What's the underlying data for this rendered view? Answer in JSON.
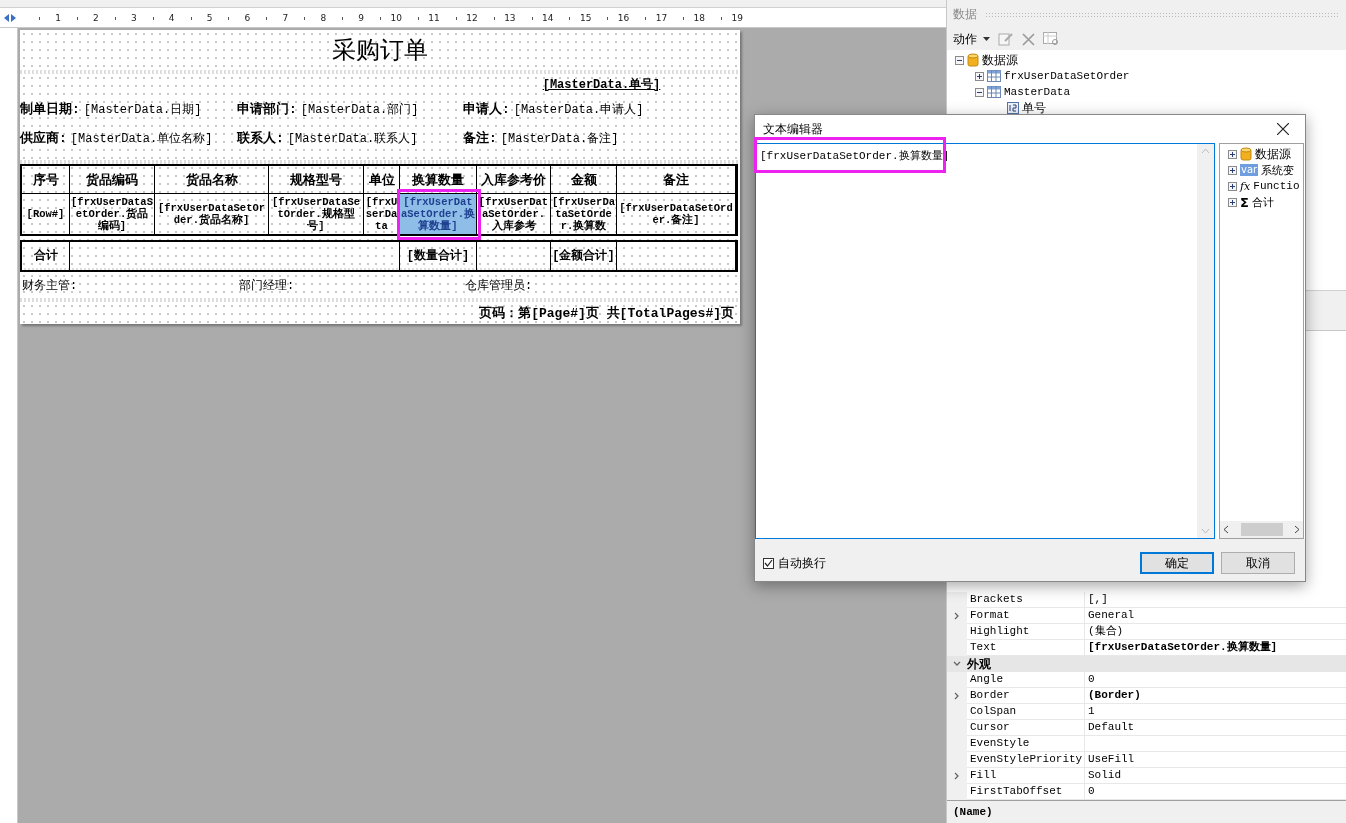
{
  "ruler": {
    "ticks": [
      "1",
      "2",
      "3",
      "4",
      "5",
      "6",
      "7",
      "8",
      "9",
      "10",
      "11",
      "12",
      "13",
      "14",
      "15",
      "16",
      "17",
      "18",
      "19"
    ]
  },
  "report": {
    "title": "采购订单",
    "order_number": "[MasterData.单号]",
    "header_rows": [
      [
        {
          "label": "制单日期:",
          "value": "[MasterData.日期]"
        },
        {
          "label": "申请部门:",
          "value": "[MasterData.部门]"
        },
        {
          "label": "申请人:",
          "value": "[MasterData.申请人]"
        }
      ],
      [
        {
          "label": "供应商:",
          "value": "[MasterData.单位名称]"
        },
        {
          "label": "联系人:",
          "value": "[MasterData.联系人]"
        },
        {
          "label": "备注:",
          "value": "[MasterData.备注]"
        }
      ]
    ],
    "columns": [
      "序号",
      "货品编码",
      "货品名称",
      "规格型号",
      "单位",
      "换算数量",
      "入库参考价",
      "金额",
      "备注"
    ],
    "data_row": [
      {
        "text": "[Row#]",
        "selected": false
      },
      {
        "text": "[frxUserDataSetOrder.货品编码]",
        "selected": false
      },
      {
        "text": "[frxUserDataSetOrder.货品名称]",
        "selected": false
      },
      {
        "text": "[frxUserDataSetOrder.规格型号]",
        "selected": false
      },
      {
        "text": "[frxUserData",
        "selected": false
      },
      {
        "text": "[frxUserDataSetOrder.换算数量]",
        "selected": true,
        "highlighted": true
      },
      {
        "text": "[frxUserDataSetOrder.入库参考",
        "selected": false
      },
      {
        "text": "[frxUserDataSetOrder.换算数",
        "selected": false
      },
      {
        "text": "[frxUserDataSetOrder.备注]",
        "selected": false
      }
    ],
    "totals": {
      "label": "合计",
      "quantity": "[数量合计]",
      "amount": "[金额合计]"
    },
    "signatures": [
      "财务主管:",
      "部门经理:",
      "仓库管理员:"
    ],
    "page_footer": "页码：第[Page#]页 共[TotalPages#]页"
  },
  "data_panel": {
    "title": "数据",
    "action": "动作",
    "tree": [
      {
        "label": "数据源",
        "kind": "database",
        "expanded": true,
        "children": [
          {
            "label": "frxUserDataSetOrder",
            "kind": "table",
            "expanded": false
          },
          {
            "label": "MasterData",
            "kind": "table",
            "expanded": true,
            "children": [
              {
                "label": "单号",
                "kind": "field"
              }
            ]
          }
        ]
      }
    ]
  },
  "properties": {
    "rows": [
      {
        "kind": "property",
        "name": "Brackets",
        "value": "[,]"
      },
      {
        "kind": "property",
        "name": "Format",
        "value": "General",
        "expandable": true
      },
      {
        "kind": "property",
        "name": "Highlight",
        "value": "(集合)"
      },
      {
        "kind": "property",
        "name": "Text",
        "value": "[frxUserDataSetOrder.换算数量]",
        "bold": true
      },
      {
        "kind": "category",
        "name": "外观",
        "expanded": true
      },
      {
        "kind": "property",
        "name": "Angle",
        "value": "0"
      },
      {
        "kind": "property",
        "name": "Border",
        "value": "(Border)",
        "expandable": true,
        "bold": true
      },
      {
        "kind": "property",
        "name": "ColSpan",
        "value": "1"
      },
      {
        "kind": "property",
        "name": "Cursor",
        "value": "Default"
      },
      {
        "kind": "property",
        "name": "EvenStyle"
      },
      {
        "kind": "property",
        "name": "EvenStylePriority",
        "value": "UseFill"
      },
      {
        "kind": "property",
        "name": "Fill",
        "value": "Solid",
        "expandable": true
      },
      {
        "kind": "property",
        "name": "FirstTabOffset",
        "value": "0"
      }
    ],
    "description": "(Name)"
  },
  "dialog": {
    "title": "文本编辑器",
    "text": "[frxUserDataSetOrder.换算数量]",
    "text_highlighted": true,
    "tree": [
      {
        "label": "数据源",
        "kind": "database",
        "expanded": false
      },
      {
        "label": "系统变",
        "kind": "variables",
        "icon_label": "var",
        "expanded": false
      },
      {
        "label": "Functio",
        "kind": "function",
        "icon_label": "fx",
        "expanded": false
      },
      {
        "label": "合计",
        "kind": "total",
        "icon_label": "Σ",
        "expanded": false
      }
    ],
    "word_wrap": {
      "label": "自动换行",
      "checked": true
    },
    "buttons": [
      {
        "label": "确定",
        "default": true
      },
      {
        "label": "取消",
        "default": false
      }
    ]
  }
}
